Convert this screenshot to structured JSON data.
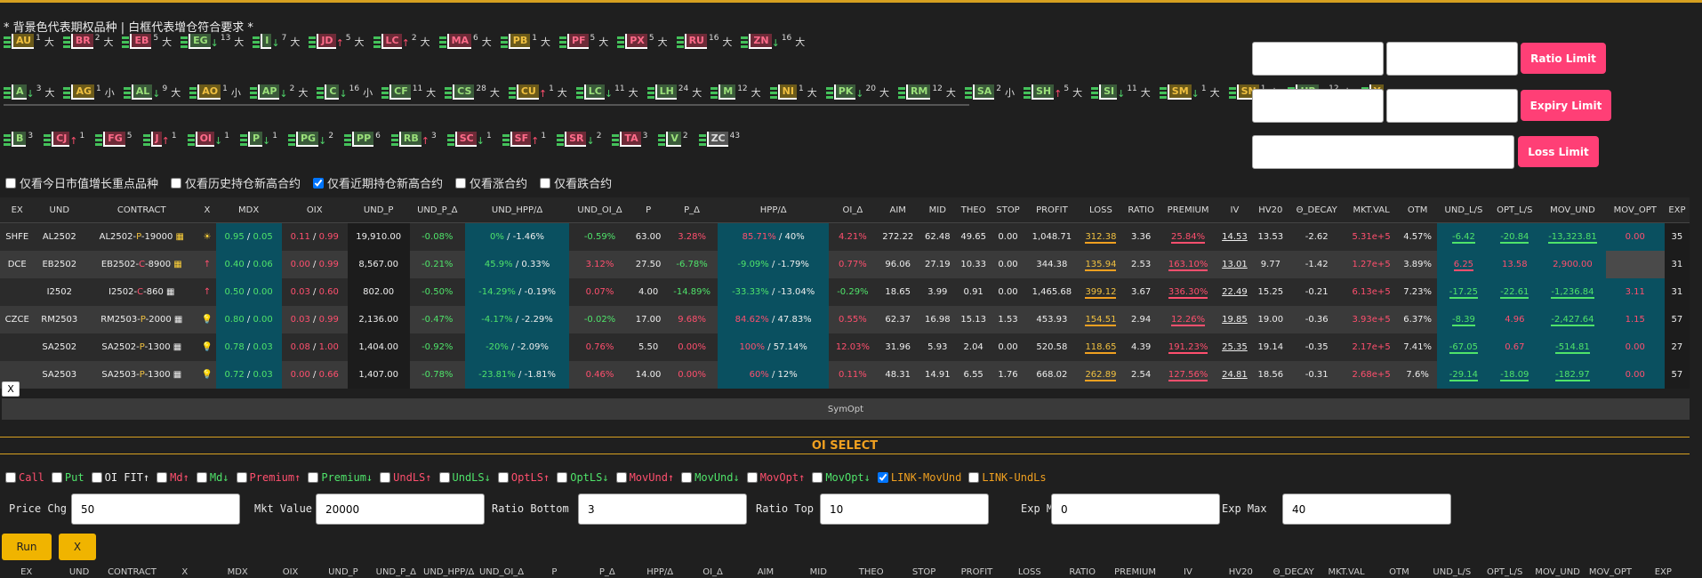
{
  "legend": "* 背景色代表期权品种 | 白框代表增仓符合要求 *",
  "chip_rows": [
    [
      {
        "code": "AU",
        "arrow": "",
        "sup": "1",
        "suffix": "大",
        "color": "y"
      },
      {
        "code": "BR",
        "arrow": "",
        "sup": "2",
        "suffix": "大",
        "color": "r"
      },
      {
        "code": "EB",
        "arrow": "",
        "sup": "5",
        "suffix": "大",
        "color": "r"
      },
      {
        "code": "EG",
        "arrow": "↓",
        "sup": "13",
        "suffix": "大",
        "color": "g"
      },
      {
        "code": "I",
        "arrow": "↓",
        "sup": "7",
        "suffix": "大",
        "color": "g"
      },
      {
        "code": "JD",
        "arrow": "↑",
        "sup": "5",
        "suffix": "大",
        "color": "r"
      },
      {
        "code": "LC",
        "arrow": "↑",
        "sup": "2",
        "suffix": "大",
        "color": "r"
      },
      {
        "code": "MA",
        "arrow": "",
        "sup": "6",
        "suffix": "大",
        "color": "r"
      },
      {
        "code": "PB",
        "arrow": "",
        "sup": "1",
        "suffix": "大",
        "color": "y"
      },
      {
        "code": "PF",
        "arrow": "",
        "sup": "5",
        "suffix": "大",
        "color": "r"
      },
      {
        "code": "PX",
        "arrow": "",
        "sup": "5",
        "suffix": "大",
        "color": "r"
      },
      {
        "code": "RU",
        "arrow": "",
        "sup": "16",
        "suffix": "大",
        "color": "r"
      },
      {
        "code": "ZN",
        "arrow": "↓",
        "sup": "16",
        "suffix": "大",
        "color": "r"
      }
    ],
    [
      {
        "code": "A",
        "arrow": "↓",
        "sup": "3",
        "suffix": "大",
        "color": "g"
      },
      {
        "code": "AG",
        "arrow": "",
        "sup": "1",
        "suffix": "小",
        "color": "y"
      },
      {
        "code": "AL",
        "arrow": "↓",
        "sup": "9",
        "suffix": "大",
        "color": "g"
      },
      {
        "code": "AO",
        "arrow": "",
        "sup": "1",
        "suffix": "小",
        "color": "y"
      },
      {
        "code": "AP",
        "arrow": "↓",
        "sup": "2",
        "suffix": "大",
        "color": "g"
      },
      {
        "code": "C",
        "arrow": "↓",
        "sup": "16",
        "suffix": "小",
        "color": "g"
      },
      {
        "code": "CF",
        "arrow": "",
        "sup": "11",
        "suffix": "大",
        "color": "g"
      },
      {
        "code": "CS",
        "arrow": "",
        "sup": "28",
        "suffix": "大",
        "color": "g"
      },
      {
        "code": "CU",
        "arrow": "↑",
        "sup": "1",
        "suffix": "大",
        "color": "y"
      },
      {
        "code": "LC",
        "arrow": "↓",
        "sup": "11",
        "suffix": "大",
        "color": "g"
      },
      {
        "code": "LH",
        "arrow": "",
        "sup": "24",
        "suffix": "大",
        "color": "g"
      },
      {
        "code": "M",
        "arrow": "",
        "sup": "12",
        "suffix": "大",
        "color": "g"
      },
      {
        "code": "NI",
        "arrow": "",
        "sup": "1",
        "suffix": "大",
        "color": "y"
      },
      {
        "code": "PK",
        "arrow": "↓",
        "sup": "20",
        "suffix": "大",
        "color": "g"
      },
      {
        "code": "RM",
        "arrow": "",
        "sup": "12",
        "suffix": "大",
        "color": "g"
      },
      {
        "code": "SA",
        "arrow": "",
        "sup": "2",
        "suffix": "小",
        "color": "g"
      },
      {
        "code": "SH",
        "arrow": "↑",
        "sup": "5",
        "suffix": "大",
        "color": "g"
      },
      {
        "code": "SI",
        "arrow": "↓",
        "sup": "11",
        "suffix": "大",
        "color": "g"
      },
      {
        "code": "SM",
        "arrow": "↓",
        "sup": "1",
        "suffix": "大",
        "color": "y"
      },
      {
        "code": "SN",
        "arrow": "",
        "sup": "1",
        "suffix": "小",
        "color": "y"
      },
      {
        "code": "UR",
        "arrow": "↓",
        "sup": "12",
        "suffix": "大",
        "color": "g"
      },
      {
        "code": "Y",
        "arrow": "",
        "sup": "",
        "suffix": "",
        "color": "y"
      }
    ],
    [
      {
        "code": "B",
        "arrow": "",
        "sup": "3",
        "suffix": "",
        "color": "g"
      },
      {
        "code": "CJ",
        "arrow": "↑",
        "sup": "1",
        "suffix": "",
        "color": "r"
      },
      {
        "code": "FG",
        "arrow": "",
        "sup": "5",
        "suffix": "",
        "color": "r"
      },
      {
        "code": "J",
        "arrow": "↑",
        "sup": "1",
        "suffix": "",
        "color": "r"
      },
      {
        "code": "OI",
        "arrow": "↓",
        "sup": "1",
        "suffix": "",
        "color": "r"
      },
      {
        "code": "P",
        "arrow": "↓",
        "sup": "1",
        "suffix": "",
        "color": "g"
      },
      {
        "code": "PG",
        "arrow": "↓",
        "sup": "2",
        "suffix": "",
        "color": "g"
      },
      {
        "code": "PP",
        "arrow": "",
        "sup": "6",
        "suffix": "",
        "color": "g"
      },
      {
        "code": "RB",
        "arrow": "↑",
        "sup": "3",
        "suffix": "",
        "color": "g"
      },
      {
        "code": "SC",
        "arrow": "↓",
        "sup": "1",
        "suffix": "",
        "color": "r"
      },
      {
        "code": "SF",
        "arrow": "↑",
        "sup": "1",
        "suffix": "",
        "color": "r"
      },
      {
        "code": "SR",
        "arrow": "↓",
        "sup": "2",
        "suffix": "",
        "color": "r"
      },
      {
        "code": "TA",
        "arrow": "",
        "sup": "3",
        "suffix": "",
        "color": "r"
      },
      {
        "code": "V",
        "arrow": "",
        "sup": "2",
        "suffix": "",
        "color": "g"
      },
      {
        "code": "ZC",
        "arrow": "",
        "sup": "43",
        "suffix": "",
        "color": "n"
      }
    ]
  ],
  "limits": {
    "ratio_btn": "Ratio Limit",
    "expiry_btn": "Expiry Limit",
    "loss_btn": "Loss Limit"
  },
  "filters": [
    {
      "label": "仅看今日市值增长重点品种",
      "checked": false
    },
    {
      "label": "仅看历史持仓新高合约",
      "checked": false
    },
    {
      "label": "仅看近期持仓新高合约",
      "checked": true
    },
    {
      "label": "仅看涨合约",
      "checked": false
    },
    {
      "label": "仅看跌合约",
      "checked": false
    }
  ],
  "table": {
    "headers": [
      "EX",
      "UND",
      "CONTRACT",
      "X",
      "MDX",
      "OIX",
      "UND_P",
      "UND_P_Δ",
      "UND_HPP/Δ",
      "UND_OI_Δ",
      "P",
      "P_Δ",
      "HPP/Δ",
      "OI_Δ",
      "AIM",
      "MID",
      "THEO",
      "STOP",
      "PROFIT",
      "LOSS",
      "RATIO",
      "PREMIUM",
      "IV",
      "HV20",
      "Θ_DECAY",
      "MKT.VAL",
      "OTM",
      "UND_L/S",
      "OPT_L/S",
      "MOV_UND",
      "MOV_OPT",
      "EXP"
    ],
    "rows": [
      {
        "ex": "SHFE",
        "und": "AL2502",
        "contract": [
          "AL2502-",
          "P",
          "-19000"
        ],
        "side": "P",
        "x": "☀",
        "mdx": [
          "0.95",
          "0.05"
        ],
        "oix": [
          "0.11",
          "0.99"
        ],
        "und_p": "19,910.00",
        "und_p_d": "-0.08%",
        "und_hpp": [
          "0%",
          "-1.46%"
        ],
        "und_oi": "-0.59%",
        "p": "63.00",
        "p_d": "3.28%",
        "hpp": [
          "85.71%",
          "40%"
        ],
        "oi_d": "4.21%",
        "aim": "272.22",
        "mid": "62.48",
        "theo": "49.65",
        "stop": "0.00",
        "profit": "1,048.71",
        "loss": "312.38",
        "ratio": "3.36",
        "premium": "25.84%",
        "iv": "14.53",
        "hv": "13.53",
        "decay": "-2.62",
        "mkt": "5.31e+5",
        "otm": "4.57%",
        "und_ls": "-6.42",
        "opt_ls": "-20.84",
        "mov_und": "-13,323.81",
        "mov_opt": "0.00",
        "exp": "35"
      },
      {
        "ex": "DCE",
        "und": "EB2502",
        "contract": [
          "EB2502-",
          "C",
          "-8900"
        ],
        "side": "C",
        "x": "↑",
        "mdx": [
          "0.40",
          "0.06"
        ],
        "oix": [
          "0.00",
          "0.99"
        ],
        "und_p": "8,567.00",
        "und_p_d": "-0.21%",
        "und_hpp": [
          "45.9%",
          "0.33%"
        ],
        "und_oi": "3.12%",
        "p": "27.50",
        "p_d": "-6.78%",
        "hpp": [
          "-9.09%",
          "-1.79%"
        ],
        "oi_d": "0.77%",
        "aim": "96.06",
        "mid": "27.19",
        "theo": "10.33",
        "stop": "0.00",
        "profit": "344.38",
        "loss": "135.94",
        "ratio": "2.53",
        "premium": "163.10%",
        "iv": "13.01",
        "hv": "9.77",
        "decay": "-1.42",
        "mkt": "1.27e+5",
        "otm": "3.89%",
        "und_ls": "6.25",
        "opt_ls": "13.58",
        "mov_und": "2,900.00",
        "mov_opt": "",
        "exp": "31"
      },
      {
        "ex": "",
        "und": "I2502",
        "contract": [
          "I2502-",
          "C",
          "-860"
        ],
        "side": "C",
        "x": "↑",
        "mdx": [
          "0.50",
          "0.00"
        ],
        "oix": [
          "0.03",
          "0.60"
        ],
        "und_p": "802.00",
        "und_p_d": "-0.50%",
        "und_hpp": [
          "-14.29%",
          "-0.19%"
        ],
        "und_oi": "0.07%",
        "p": "4.00",
        "p_d": "-14.89%",
        "hpp": [
          "-33.33%",
          "-13.04%"
        ],
        "oi_d": "-0.29%",
        "aim": "18.65",
        "mid": "3.99",
        "theo": "0.91",
        "stop": "0.00",
        "profit": "1,465.68",
        "loss": "399.12",
        "ratio": "3.67",
        "premium": "336.30%",
        "iv": "22.49",
        "hv": "15.25",
        "decay": "-0.21",
        "mkt": "6.13e+5",
        "otm": "7.23%",
        "und_ls": "-17.25",
        "opt_ls": "-22.61",
        "mov_und": "-1,236.84",
        "mov_opt": "3.11",
        "exp": "31"
      },
      {
        "ex": "CZCE",
        "und": "RM2503",
        "contract": [
          "RM2503-",
          "P",
          "-2000"
        ],
        "side": "P",
        "x": "💡",
        "mdx": [
          "0.80",
          "0.00"
        ],
        "oix": [
          "0.03",
          "0.99"
        ],
        "und_p": "2,136.00",
        "und_p_d": "-0.47%",
        "und_hpp": [
          "-4.17%",
          "-2.29%"
        ],
        "und_oi": "-0.02%",
        "p": "17.00",
        "p_d": "9.68%",
        "hpp": [
          "84.62%",
          "47.83%"
        ],
        "oi_d": "0.55%",
        "aim": "62.37",
        "mid": "16.98",
        "theo": "15.13",
        "stop": "1.53",
        "profit": "453.93",
        "loss": "154.51",
        "ratio": "2.94",
        "premium": "12.26%",
        "iv": "19.85",
        "hv": "19.00",
        "decay": "-0.36",
        "mkt": "3.93e+5",
        "otm": "6.37%",
        "und_ls": "-8.39",
        "opt_ls": "4.96",
        "mov_und": "-2,427.64",
        "mov_opt": "1.15",
        "exp": "57"
      },
      {
        "ex": "",
        "und": "SA2502",
        "contract": [
          "SA2502-",
          "P",
          "-1300"
        ],
        "side": "P",
        "x": "💡",
        "mdx": [
          "0.78",
          "0.03"
        ],
        "oix": [
          "0.08",
          "1.00"
        ],
        "und_p": "1,404.00",
        "und_p_d": "-0.92%",
        "und_hpp": [
          "-20%",
          "-2.09%"
        ],
        "und_oi": "0.76%",
        "p": "5.50",
        "p_d": "0.00%",
        "hpp": [
          "100%",
          "57.14%"
        ],
        "oi_d": "12.03%",
        "aim": "31.96",
        "mid": "5.93",
        "theo": "2.04",
        "stop": "0.00",
        "profit": "520.58",
        "loss": "118.65",
        "ratio": "4.39",
        "premium": "191.23%",
        "iv": "25.35",
        "hv": "19.14",
        "decay": "-0.35",
        "mkt": "2.17e+5",
        "otm": "7.41%",
        "und_ls": "-67.05",
        "opt_ls": "0.67",
        "mov_und": "-514.81",
        "mov_opt": "0.00",
        "exp": "27"
      },
      {
        "ex": "",
        "und": "SA2503",
        "contract": [
          "SA2503-",
          "P",
          "-1300"
        ],
        "side": "P",
        "x": "💡",
        "mdx": [
          "0.72",
          "0.03"
        ],
        "oix": [
          "0.00",
          "0.66"
        ],
        "und_p": "1,407.00",
        "und_p_d": "-0.78%",
        "und_hpp": [
          "-23.81%",
          "-1.81%"
        ],
        "und_oi": "0.46%",
        "p": "14.00",
        "p_d": "0.00%",
        "hpp": [
          "60%",
          "12%"
        ],
        "oi_d": "0.11%",
        "aim": "48.31",
        "mid": "14.91",
        "theo": "6.55",
        "stop": "1.76",
        "profit": "668.02",
        "loss": "262.89",
        "ratio": "2.54",
        "premium": "127.56%",
        "iv": "24.81",
        "hv": "18.56",
        "decay": "-0.31",
        "mkt": "2.68e+5",
        "otm": "7.6%",
        "und_ls": "-29.14",
        "opt_ls": "-18.09",
        "mov_und": "-182.97",
        "mov_opt": "0.00",
        "exp": "57"
      }
    ]
  },
  "close_label": "X",
  "symopt_label": "SymOpt",
  "oi_select_title": "OI SELECT",
  "oi_checks": [
    {
      "label": "Call",
      "checked": false,
      "color": "#ff4f6e"
    },
    {
      "label": "Put",
      "checked": false,
      "color": "#4fe36a"
    },
    {
      "label": "OI FIT↑",
      "checked": false,
      "color": "#eeeeee"
    },
    {
      "label": "Md↑",
      "checked": false,
      "color": "#ff4f6e"
    },
    {
      "label": "Md↓",
      "checked": false,
      "color": "#4fe36a"
    },
    {
      "label": "Premium↑",
      "checked": false,
      "color": "#ff4f6e"
    },
    {
      "label": "Premium↓",
      "checked": false,
      "color": "#4fe36a"
    },
    {
      "label": "UndLS↑",
      "checked": false,
      "color": "#ff4f6e"
    },
    {
      "label": "UndLS↓",
      "checked": false,
      "color": "#4fe36a"
    },
    {
      "label": "OptLS↑",
      "checked": false,
      "color": "#ff4f6e"
    },
    {
      "label": "OptLS↓",
      "checked": false,
      "color": "#4fe36a"
    },
    {
      "label": "MovUnd↑",
      "checked": false,
      "color": "#ff4f6e"
    },
    {
      "label": "MovUnd↓",
      "checked": false,
      "color": "#4fe36a"
    },
    {
      "label": "MovOpt↑",
      "checked": false,
      "color": "#ff4f6e"
    },
    {
      "label": "MovOpt↓",
      "checked": false,
      "color": "#4fe36a"
    },
    {
      "label": "LINK-MovUnd",
      "checked": true,
      "color": "#f0a020"
    },
    {
      "label": "LINK-UndLs",
      "checked": false,
      "color": "#f0a020"
    }
  ],
  "inputs": [
    {
      "label": "Price Chg",
      "value": "50"
    },
    {
      "label": "Mkt Value",
      "value": "20000"
    },
    {
      "label": "Ratio Bottom",
      "value": "3"
    },
    {
      "label": "Ratio Top",
      "value": "10"
    },
    {
      "label": "Exp Min",
      "value": "0"
    },
    {
      "label": "Exp Max",
      "value": "40"
    }
  ],
  "run_label": "Run",
  "x_label": "X"
}
